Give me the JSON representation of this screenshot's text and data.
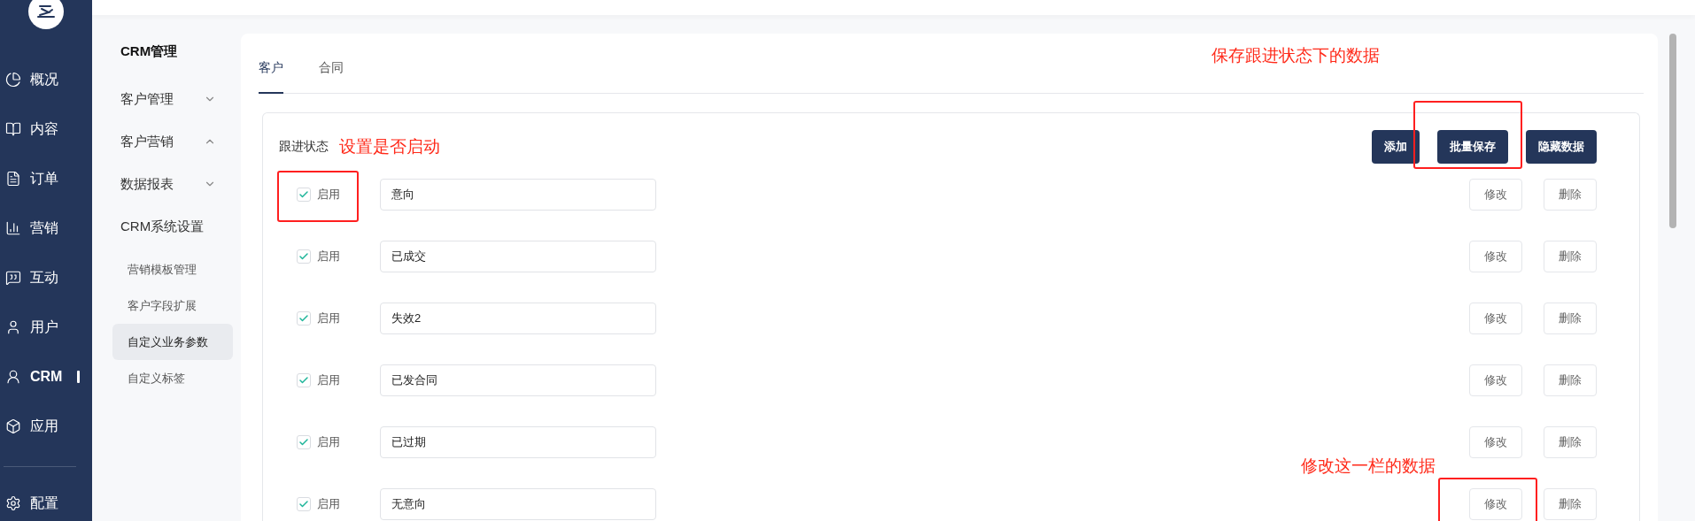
{
  "nav": {
    "items": [
      {
        "label": "概况",
        "selected": false
      },
      {
        "label": "内容",
        "selected": false
      },
      {
        "label": "订单",
        "selected": false
      },
      {
        "label": "营销",
        "selected": false
      },
      {
        "label": "互动",
        "selected": false
      },
      {
        "label": "用户",
        "selected": false
      },
      {
        "label": "CRM",
        "selected": true
      },
      {
        "label": "应用",
        "selected": false
      }
    ],
    "footer": {
      "label": "配置",
      "selected": false
    }
  },
  "subnav": {
    "title": "CRM管理",
    "groups": [
      {
        "label": "客户管理",
        "expanded": false
      },
      {
        "label": "客户营销",
        "expanded": true
      },
      {
        "label": "数据报表",
        "expanded": false
      },
      {
        "label": "CRM系统设置",
        "children": [
          {
            "label": "营销模板管理",
            "selected": false
          },
          {
            "label": "客户字段扩展",
            "selected": false
          },
          {
            "label": "自定义业务参数",
            "selected": true
          },
          {
            "label": "自定义标签",
            "selected": false
          }
        ]
      }
    ]
  },
  "tabs": [
    {
      "label": "客户",
      "selected": true
    },
    {
      "label": "合同",
      "selected": false
    }
  ],
  "card_note": "保存跟进状态下的数据",
  "panel": {
    "title": "跟进状态",
    "note": "设置是否启动",
    "buttons": [
      {
        "label": "添加",
        "annotated": false
      },
      {
        "label": "批量保存",
        "annotated": true
      },
      {
        "label": "隐藏数据",
        "annotated": false
      }
    ],
    "rows_note": "修改这一栏的数据",
    "rows": [
      {
        "enabled": true,
        "enable_label": "启用",
        "value": "意向",
        "edit": "修改",
        "delete": "删除",
        "check_annotated": true,
        "edit_annotated": false
      },
      {
        "enabled": true,
        "enable_label": "启用",
        "value": "已成交",
        "edit": "修改",
        "delete": "删除",
        "check_annotated": false,
        "edit_annotated": false
      },
      {
        "enabled": true,
        "enable_label": "启用",
        "value": "失效2",
        "edit": "修改",
        "delete": "删除",
        "check_annotated": false,
        "edit_annotated": false
      },
      {
        "enabled": true,
        "enable_label": "启用",
        "value": "已发合同",
        "edit": "修改",
        "delete": "删除",
        "check_annotated": false,
        "edit_annotated": false
      },
      {
        "enabled": true,
        "enable_label": "启用",
        "value": "已过期",
        "edit": "修改",
        "delete": "删除",
        "check_annotated": false,
        "edit_annotated": false
      },
      {
        "enabled": true,
        "enable_label": "启用",
        "value": "无意向",
        "edit": "修改",
        "delete": "删除",
        "check_annotated": false,
        "edit_annotated": true
      }
    ]
  }
}
